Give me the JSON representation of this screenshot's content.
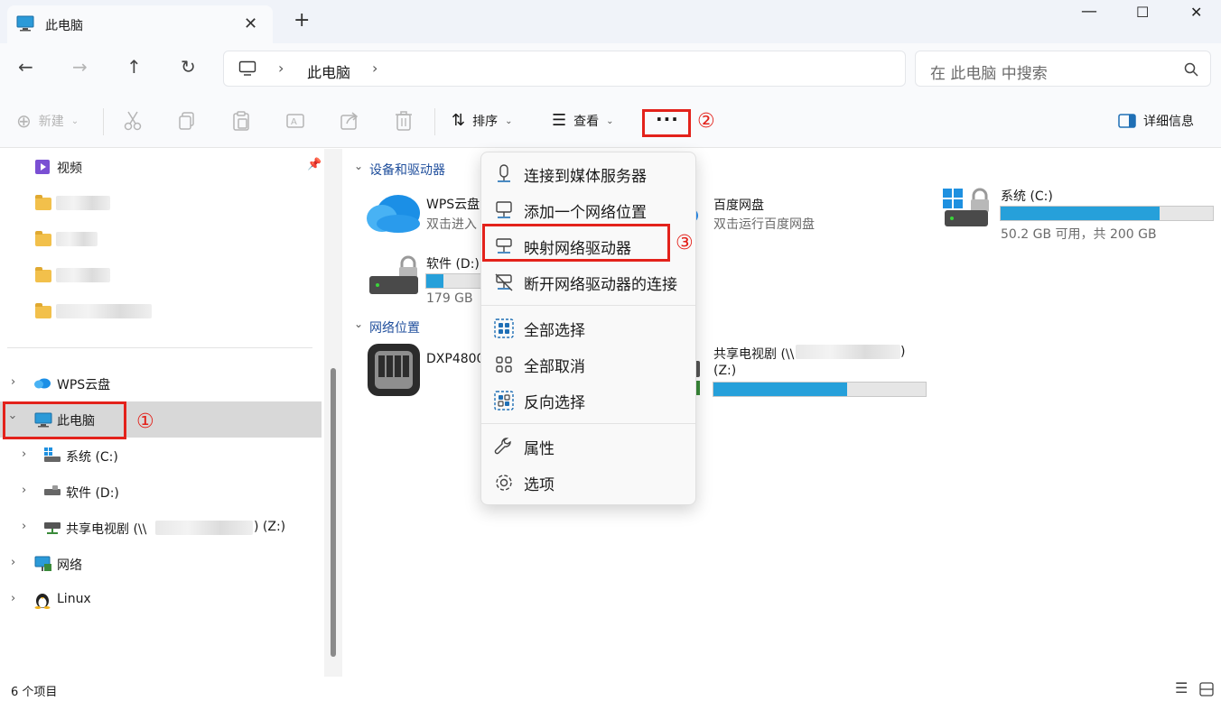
{
  "window": {
    "tab_title": "此电脑",
    "new_tab": "+",
    "minimize": "—",
    "maximize": "☐",
    "close": "✕",
    "tab_close": "✕"
  },
  "nav": {
    "breadcrumb_location": "此电脑",
    "breadcrumb_sep": "›",
    "search_placeholder": "在 此电脑 中搜索"
  },
  "toolbar": {
    "new_label": "新建",
    "sort_label": "排序",
    "view_label": "查看",
    "more_label": "···",
    "details_label": "详细信息"
  },
  "annotations": {
    "marker_1": "①",
    "marker_2": "②",
    "marker_3": "③"
  },
  "sidebar": {
    "quick_access": [
      {
        "label": "视频"
      }
    ],
    "wps_cloud": "WPS云盘",
    "this_pc": "此电脑",
    "drives": [
      "系统 (C:)",
      "软件 (D:)"
    ],
    "share_prefix": "共享电视剧 (\\\\",
    "share_suffix": ") (Z:)",
    "network": "网络",
    "linux": "Linux"
  },
  "content": {
    "devices_header": "设备和驱动器",
    "network_header": "网络位置",
    "wps": {
      "name": "WPS云盘",
      "sub": "双击进入"
    },
    "baidu": {
      "name": "百度网盘",
      "sub": "双击运行百度网盘"
    },
    "c_drive": {
      "name": "系统 (C:)",
      "sub": "50.2 GB 可用，共 200 GB",
      "used_fraction": 0.75
    },
    "d_drive": {
      "name": "软件 (D:)",
      "sub": "179 GB",
      "used_fraction": 0.3
    },
    "dxp": {
      "name": "DXP4800"
    },
    "share": {
      "name_prefix": "共享电视剧 (\\\\",
      "name_suffix": ")",
      "drive": "(Z:)",
      "used_fraction": 0.63
    }
  },
  "context_menu": {
    "items": [
      {
        "label": "连接到媒体服务器",
        "icon": "media-server-icon"
      },
      {
        "label": "添加一个网络位置",
        "icon": "network-location-icon"
      },
      {
        "label": "映射网络驱动器",
        "icon": "map-drive-icon"
      },
      {
        "label": "断开网络驱动器的连接",
        "icon": "disconnect-drive-icon"
      },
      {
        "label": "全部选择",
        "icon": "select-all-icon"
      },
      {
        "label": "全部取消",
        "icon": "select-none-icon"
      },
      {
        "label": "反向选择",
        "icon": "invert-selection-icon"
      },
      {
        "label": "属性",
        "icon": "wrench-icon"
      },
      {
        "label": "选项",
        "icon": "gear-icon"
      }
    ]
  },
  "status": {
    "item_count": "6 个项目"
  },
  "colors": {
    "accent": "#26a0da",
    "annotation_red": "#e3221b",
    "link_blue": "#1f4e9c"
  }
}
